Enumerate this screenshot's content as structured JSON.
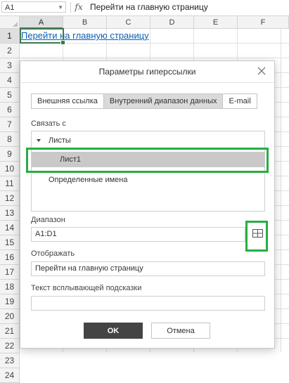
{
  "formula_bar": {
    "name_box": "A1",
    "fx": "fx",
    "formula": "Перейти на главную страницу"
  },
  "sheet": {
    "columns": [
      "A",
      "B",
      "C",
      "D",
      "E",
      "F"
    ],
    "rows": [
      "1",
      "2",
      "3",
      "4",
      "5",
      "6",
      "7",
      "8",
      "9",
      "10",
      "11",
      "12",
      "13",
      "14",
      "15",
      "16",
      "17",
      "18",
      "19",
      "20",
      "21",
      "22",
      "23",
      "24"
    ],
    "a1_text": "Перейти на главную страницу"
  },
  "dialog": {
    "title": "Параметры гиперссылки",
    "tabs": [
      "Внешняя ссылка",
      "Внутренний диапазон данных",
      "E-mail"
    ],
    "active_tab_index": 1,
    "link_to_label": "Связать с",
    "tree": {
      "group": "Листы",
      "selected_sheet": "Лист1",
      "defined_names": "Определенные имена"
    },
    "range_label": "Диапазон",
    "range_value": "A1:D1",
    "display_label": "Отображать",
    "display_value": "Перейти на главную страницу",
    "tooltip_label": "Текст всплывающей подсказки",
    "tooltip_value": "",
    "ok_label": "OK",
    "cancel_label": "Отмена"
  },
  "colors": {
    "annotation_green": "#27ad44",
    "link_blue": "#0b5fb3",
    "selection_green": "#3a7b4b"
  },
  "icons": {
    "close": "close-icon",
    "range_select": "select-range-icon",
    "tree_caret": "caret-down-icon"
  }
}
